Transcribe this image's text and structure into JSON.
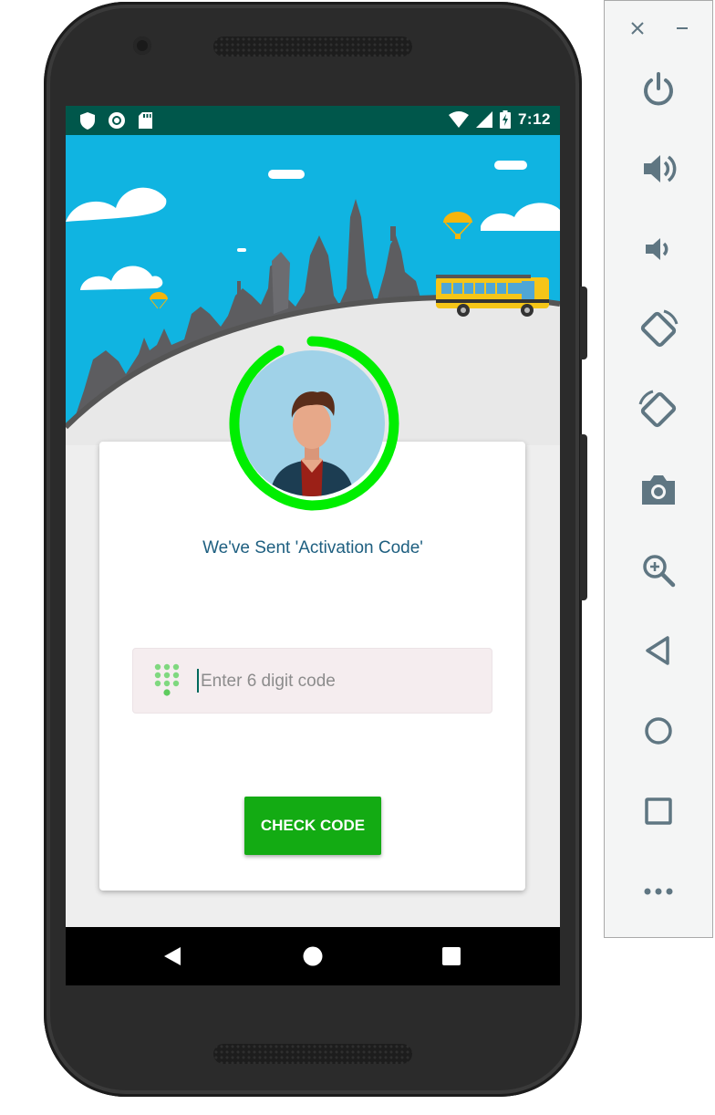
{
  "status_bar": {
    "time": "7:12"
  },
  "card": {
    "title": "We've Sent 'Activation Code'",
    "code_input": {
      "placeholder": "Enter 6 digit code",
      "value": ""
    },
    "check_button_label": "CHECK CODE"
  },
  "colors": {
    "status_bar": "#00574b",
    "sky": "#10b4e1",
    "progress_ring": "#00ee00",
    "button": "#13ab13",
    "title_text": "#1e5f80"
  },
  "toolbar": {
    "items": [
      "close-icon",
      "minimize-icon",
      "power-icon",
      "volume-up-icon",
      "volume-down-icon",
      "rotate-left-icon",
      "rotate-right-icon",
      "camera-icon",
      "zoom-icon",
      "back-icon",
      "home-icon",
      "overview-icon",
      "more-icon"
    ]
  },
  "nav_bar": {
    "items": [
      "back-icon",
      "home-icon",
      "recents-icon"
    ]
  }
}
